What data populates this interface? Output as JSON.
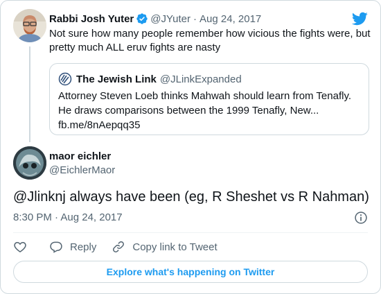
{
  "parent_tweet": {
    "author_name": "Rabbi Josh Yuter",
    "handle": "@JYuter",
    "separator": "·",
    "date": "Aug 24, 2017",
    "text": "Not sure how many people remember how vicious the fights were, but pretty much ALL eruv fights are nasty"
  },
  "quoted_tweet": {
    "author_name": "The Jewish Link",
    "handle": "@JLinkExpanded",
    "text": "Attorney Steven Loeb thinks Mahwah should learn from Tenafly. He draws comparisons between the 1999 Tenafly, New...",
    "link": "fb.me/8nAepqq35"
  },
  "main_tweet": {
    "author_name": "maor eichler",
    "handle": "@EichlerMaor",
    "text": "@Jlinknj always have been (eg, R Sheshet vs R Nahman)",
    "timestamp": "8:30 PM · Aug 24, 2017"
  },
  "actions": {
    "like_icon": "heart-icon",
    "reply_label": "Reply",
    "copy_label": "Copy link to Tweet"
  },
  "explore_label": "Explore what's happening on Twitter",
  "colors": {
    "brand": "#1d9bf0",
    "text": "#0f1419",
    "muted": "#536471",
    "border": "#cfd9de"
  }
}
